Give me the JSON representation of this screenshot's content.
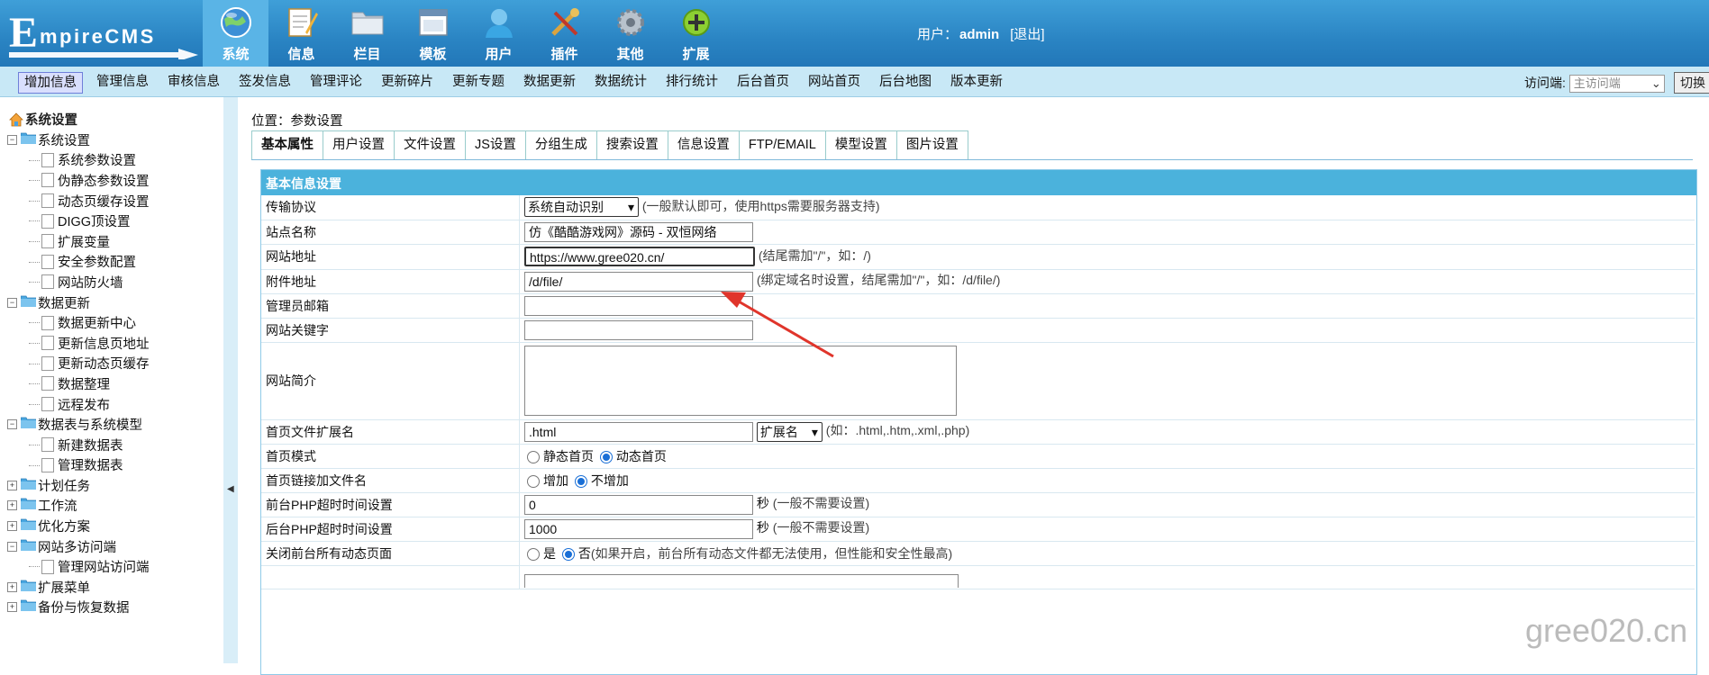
{
  "app": {
    "brand": "EmpireCMS"
  },
  "nav": [
    {
      "label": "系统",
      "icon": "globe-icon",
      "active": true
    },
    {
      "label": "信息",
      "icon": "notepad-icon"
    },
    {
      "label": "栏目",
      "icon": "folder-icon"
    },
    {
      "label": "模板",
      "icon": "window-icon"
    },
    {
      "label": "用户",
      "icon": "user-icon"
    },
    {
      "label": "插件",
      "icon": "tools-icon"
    },
    {
      "label": "其他",
      "icon": "gear-icon"
    },
    {
      "label": "扩展",
      "icon": "plus-circle-icon"
    }
  ],
  "user": {
    "prefix": "用户：",
    "name": "admin",
    "logout": "[退出]"
  },
  "submenu": [
    "增加信息",
    "管理信息",
    "审核信息",
    "签发信息",
    "管理评论",
    "更新碎片",
    "更新专题",
    "数据更新",
    "数据统计",
    "排行统计",
    "后台首页",
    "网站首页",
    "后台地图",
    "版本更新"
  ],
  "access": {
    "label": "访问端:",
    "value": "主访问端",
    "switch": "切换"
  },
  "sidebar": {
    "root": "系统设置",
    "tree": [
      {
        "type": "group",
        "label": "系统设置",
        "state": "open"
      },
      {
        "type": "leaf",
        "label": "系统参数设置"
      },
      {
        "type": "leaf",
        "label": "伪静态参数设置"
      },
      {
        "type": "leaf",
        "label": "动态页缓存设置"
      },
      {
        "type": "leaf",
        "label": "DIGG顶设置"
      },
      {
        "type": "leaf",
        "label": "扩展变量"
      },
      {
        "type": "leaf",
        "label": "安全参数配置"
      },
      {
        "type": "leaf",
        "label": "网站防火墙"
      },
      {
        "type": "group",
        "label": "数据更新",
        "state": "open"
      },
      {
        "type": "leaf",
        "label": "数据更新中心"
      },
      {
        "type": "leaf",
        "label": "更新信息页地址"
      },
      {
        "type": "leaf",
        "label": "更新动态页缓存"
      },
      {
        "type": "leaf",
        "label": "数据整理"
      },
      {
        "type": "leaf",
        "label": "远程发布"
      },
      {
        "type": "group",
        "label": "数据表与系统模型",
        "state": "open"
      },
      {
        "type": "leaf",
        "label": "新建数据表"
      },
      {
        "type": "leaf",
        "label": "管理数据表"
      },
      {
        "type": "group",
        "label": "计划任务",
        "state": "closed"
      },
      {
        "type": "group",
        "label": "工作流",
        "state": "closed"
      },
      {
        "type": "group",
        "label": "优化方案",
        "state": "closed"
      },
      {
        "type": "group",
        "label": "网站多访问端",
        "state": "open"
      },
      {
        "type": "leaf",
        "label": "管理网站访问端"
      },
      {
        "type": "group",
        "label": "扩展菜单",
        "state": "closed"
      },
      {
        "type": "group",
        "label": "备份与恢复数据",
        "state": "closed"
      }
    ]
  },
  "breadcrumb": {
    "prefix": "位置：",
    "page": "参数设置"
  },
  "tabs": [
    "基本属性",
    "用户设置",
    "文件设置",
    "JS设置",
    "分组生成",
    "搜索设置",
    "信息设置",
    "FTP/EMAIL",
    "模型设置",
    "图片设置"
  ],
  "panel": {
    "title": "基本信息设置"
  },
  "form": {
    "protocol": {
      "label": "传输协议",
      "value": "系统自动识别",
      "hint": "(一般默认即可，使用https需要服务器支持)"
    },
    "sitename": {
      "label": "站点名称",
      "value": "仿《酷酷游戏网》源码 - 双恒网络"
    },
    "siteurl": {
      "label": "网站地址",
      "value": "https://www.gree020.cn/",
      "hint": "(结尾需加\"/\"，如：/)"
    },
    "attachurl": {
      "label": "附件地址",
      "value": "/d/file/",
      "hint": "(绑定域名时设置，结尾需加\"/\"，如：/d/file/)"
    },
    "email": {
      "label": "管理员邮箱",
      "value": ""
    },
    "keywords": {
      "label": "网站关键字",
      "value": ""
    },
    "intro": {
      "label": "网站简介",
      "value": ""
    },
    "ext": {
      "label": "首页文件扩展名",
      "value": ".html",
      "select": "扩展名",
      "hint": "(如：.html,.htm,.xml,.php)"
    },
    "mode": {
      "label": "首页模式",
      "opt1": "静态首页",
      "opt2": "动态首页",
      "selected": 2
    },
    "linkfile": {
      "label": "首页链接加文件名",
      "opt1": "增加",
      "opt2": "不增加",
      "selected": 2
    },
    "fronttimeout": {
      "label": "前台PHP超时时间设置",
      "value": "0",
      "unit": "秒",
      "hint": "(一般不需要设置)"
    },
    "backtimeout": {
      "label": "后台PHP超时时间设置",
      "value": "1000",
      "unit": "秒",
      "hint": "(一般不需要设置)"
    },
    "closedyn": {
      "label": "关闭前台所有动态页面",
      "opt1": "是",
      "opt2": "否",
      "selected": 2,
      "hint": "(如果开启，前台所有动态文件都无法使用，但性能和安全性最高)"
    }
  },
  "watermark": "gree020.cn",
  "colors": {
    "header": "#2a84c3",
    "submenu": "#c8e8f6",
    "panelHead": "#4bb2dc",
    "arrow": "#e0352b"
  }
}
